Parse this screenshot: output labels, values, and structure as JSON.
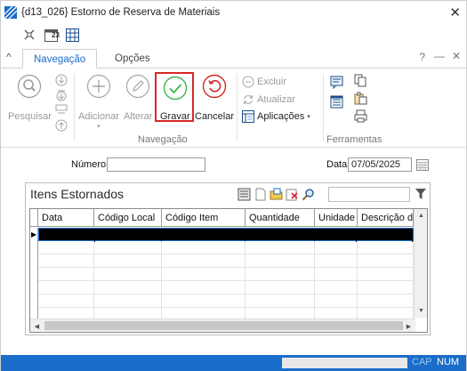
{
  "window": {
    "title": "{d13_026} Estorno de Reserva de Materiais",
    "close_glyph": "✕"
  },
  "quick_access": [
    "grid-layout-icon",
    "calendar-icon",
    "table-icon"
  ],
  "calendar_day": "23",
  "tabs": [
    {
      "label": "Navegação",
      "active": true
    },
    {
      "label": "Opções",
      "active": false
    }
  ],
  "help": {
    "glyph": "?",
    "minimize_glyph": "—",
    "close_glyph": "✕",
    "collapse_glyph": "^"
  },
  "ribbon": {
    "buttons": {
      "pesquisar": "Pesquisar",
      "adicionar": "Adicionar",
      "alterar": "Alterar",
      "gravar": "Gravar",
      "cancelar": "Cancelar",
      "excluir": "Excluir",
      "atualizar": "Atualizar",
      "aplicacoes": "Aplicações"
    },
    "groups": {
      "navegacao": "Navegação",
      "ferramentas": "Ferramentas"
    }
  },
  "form": {
    "numero_label": "Número",
    "numero_value": "",
    "data_label": "Data",
    "data_value": "07/05/2025"
  },
  "grid": {
    "title": "Itens Estornados",
    "search_value": "",
    "columns": [
      "Data",
      "Código Local",
      "Código Item",
      "Quantidade",
      "Unidade",
      "Descrição do"
    ],
    "selected_row": 0,
    "row_count": 7
  },
  "status": {
    "cap": "CAP",
    "num": "NUM"
  },
  "colors": {
    "accent": "#1a6ec9",
    "gravar_green": "#3bb54a",
    "cancel_red": "#d62828",
    "highlight_border": "#d62828",
    "disabled_gray": "#9a9a9a"
  }
}
